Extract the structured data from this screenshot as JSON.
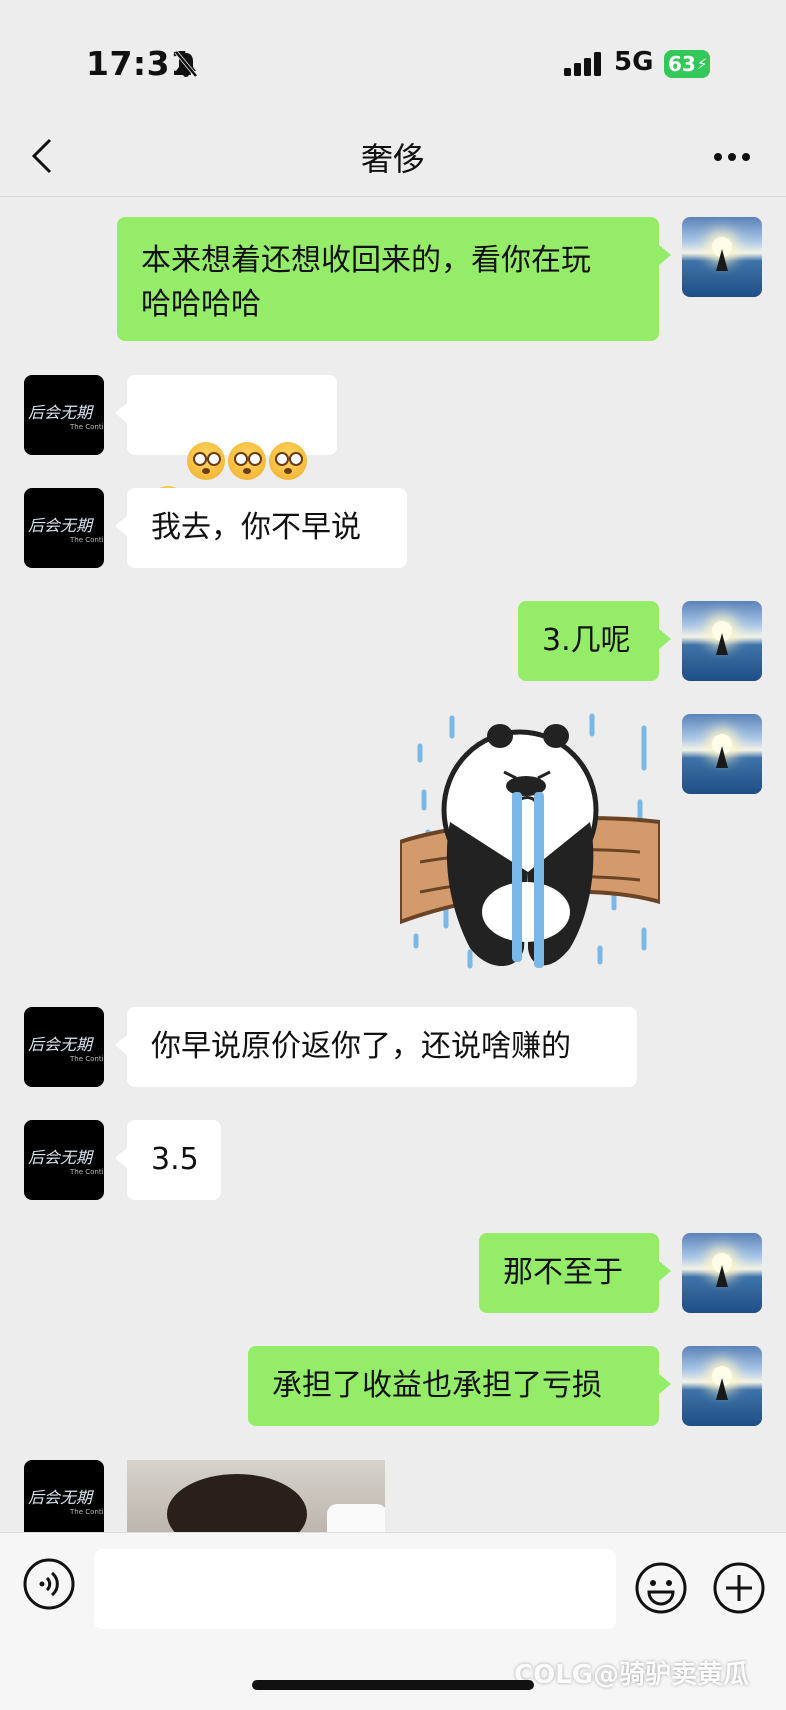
{
  "status": {
    "time": "17:31",
    "network": "5G",
    "battery": "63"
  },
  "nav": {
    "title": "奢侈"
  },
  "messages": [
    {
      "side": "self",
      "type": "text",
      "text": "本来想着还想收回来的，看你在玩\n哈哈哈哈"
    },
    {
      "side": "other",
      "type": "emoji",
      "emoji_count": 4,
      "emoji_name": "flushed-face"
    },
    {
      "side": "other",
      "type": "text",
      "text": "我去，你不早说"
    },
    {
      "side": "self",
      "type": "text",
      "text": "3.几呢"
    },
    {
      "side": "self",
      "type": "sticker",
      "sticker_name": "crying-panda-on-branch"
    },
    {
      "side": "other",
      "type": "text",
      "text": "你早说原价返你了，还说啥赚的"
    },
    {
      "side": "other",
      "type": "text",
      "text": "3.5"
    },
    {
      "side": "self",
      "type": "text",
      "text": "那不至于"
    },
    {
      "side": "self",
      "type": "text",
      "text": "承担了收益也承担了亏损"
    },
    {
      "side": "other",
      "type": "image",
      "image_name": "person-photo"
    }
  ],
  "other_avatar": {
    "text": "后会无期",
    "sub": "The Continent"
  },
  "input": {
    "placeholder": ""
  },
  "watermark": "COLG@骑驴卖黄瓜",
  "colors": {
    "self_bubble": "#95ec69",
    "other_bubble": "#ffffff",
    "background": "#ededed"
  }
}
